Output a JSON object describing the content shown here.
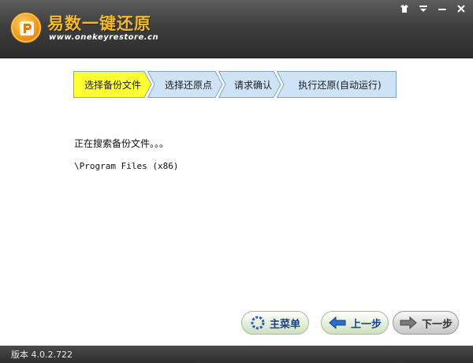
{
  "app": {
    "title": "易数一键还原",
    "url": "www.onekeyrestore.cn"
  },
  "window_controls": {
    "skin": "☰",
    "menu": "▾",
    "minimize": "—",
    "close": "✕"
  },
  "steps": [
    {
      "label": "选择备份文件",
      "active": true
    },
    {
      "label": "选择还原点",
      "active": false
    },
    {
      "label": "请求确认",
      "active": false
    },
    {
      "label": "执行还原(自动运行)",
      "active": false
    }
  ],
  "main": {
    "status": "正在搜索备份文件。。。",
    "path": "\\Program Files (x86)"
  },
  "buttons": {
    "main_menu": "主菜单",
    "prev": "上一步",
    "next": "下一步"
  },
  "footer": {
    "version": "版本 4.0.2.722"
  },
  "colors": {
    "active_step": "#ffff33",
    "inactive_step": "#cfe3f7",
    "step_border": "#7aa6cf",
    "title_orange": "#f4b92a"
  }
}
